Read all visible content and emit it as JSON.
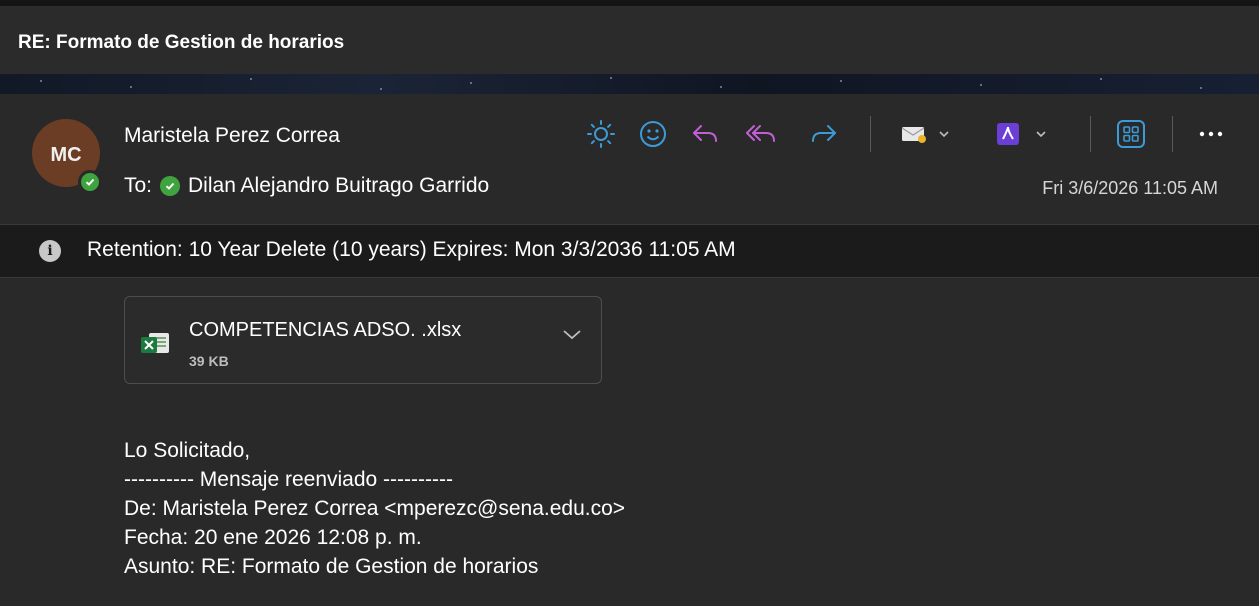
{
  "window": {
    "title": "RE: Formato de Gestion de horarios"
  },
  "header": {
    "avatar_initials": "MC",
    "sender": "Maristela Perez Correa",
    "to_label": "To:",
    "recipient": "Dilan Alejandro Buitrago Garrido",
    "date": "Fri 3/6/2026 11:05 AM"
  },
  "toolbar": {
    "icons": [
      "brightness-icon",
      "emoji-icon",
      "reply-icon",
      "reply-all-icon",
      "forward-icon",
      "mail-tag-icon",
      "adobe-pdf-icon",
      "apps-icon",
      "more-icon"
    ],
    "accent": "#3c9ad6",
    "reply_color": "#c35fd6"
  },
  "retention": {
    "text": "Retention: 10 Year Delete (10 years) Expires: Mon 3/3/2036 11:05 AM"
  },
  "attachment": {
    "name": "COMPETENCIAS ADSO. .xlsx",
    "size": "39 KB",
    "icon": "excel-file-icon"
  },
  "body": {
    "lines": [
      "Lo Solicitado,",
      "---------- Mensaje reenviado ----------",
      "De: Maristela Perez Correa <mperezc@sena.edu.co>",
      "Fecha: 20 ene 2026 12:08 p. m.",
      "Asunto: RE: Formato de Gestion de horarios"
    ]
  }
}
